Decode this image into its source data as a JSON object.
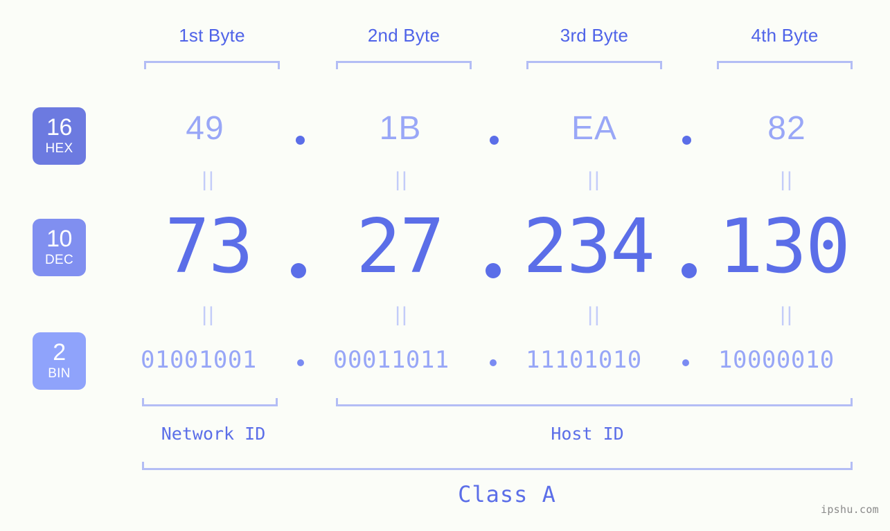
{
  "meta": {
    "watermark": "ipshu.com",
    "background_color": "#fbfdf8",
    "accent_color": "#5b6ee8",
    "accent_light": "#99a7f7",
    "bracket_color": "#b3bdf5"
  },
  "byte_headers": [
    {
      "label": "1st Byte"
    },
    {
      "label": "2nd Byte"
    },
    {
      "label": "3rd Byte"
    },
    {
      "label": "4th Byte"
    }
  ],
  "bases": [
    {
      "number": "16",
      "name": "HEX",
      "color": "#6c7ae0"
    },
    {
      "number": "10",
      "name": "DEC",
      "color": "#808ff0"
    },
    {
      "number": "2",
      "name": "BIN",
      "color": "#8fa3fb"
    }
  ],
  "rows": {
    "hex": {
      "base_number": "16",
      "base_name": "HEX",
      "values": [
        "49",
        "1B",
        "EA",
        "82"
      ],
      "separator": "."
    },
    "dec": {
      "base_number": "10",
      "base_name": "DEC",
      "values": [
        "73",
        "27",
        "234",
        "130"
      ],
      "separator": "."
    },
    "bin": {
      "base_number": "2",
      "base_name": "BIN",
      "values": [
        "01001001",
        "00011011",
        "11101010",
        "10000010"
      ],
      "separator": "."
    }
  },
  "equality_marks": [
    "||",
    "||",
    "||",
    "||",
    "||",
    "||",
    "||",
    "||"
  ],
  "sections": {
    "network_id": "Network ID",
    "host_id": "Host ID",
    "class": "Class A"
  },
  "chart_data": {
    "type": "table",
    "title": "IP address 73.27.234.130 byte breakdown",
    "columns": [
      "1st Byte",
      "2nd Byte",
      "3rd Byte",
      "4th Byte"
    ],
    "rows": [
      {
        "base": "16 HEX",
        "values": [
          "49",
          "1B",
          "EA",
          "82"
        ]
      },
      {
        "base": "10 DEC",
        "values": [
          "73",
          "27",
          "234",
          "130"
        ]
      },
      {
        "base": "2 BIN",
        "values": [
          "01001001",
          "00011011",
          "11101010",
          "10000010"
        ]
      }
    ],
    "annotations": {
      "network_id_bytes": [
        "1st Byte"
      ],
      "host_id_bytes": [
        "2nd Byte",
        "3rd Byte",
        "4th Byte"
      ],
      "class": "Class A"
    }
  }
}
